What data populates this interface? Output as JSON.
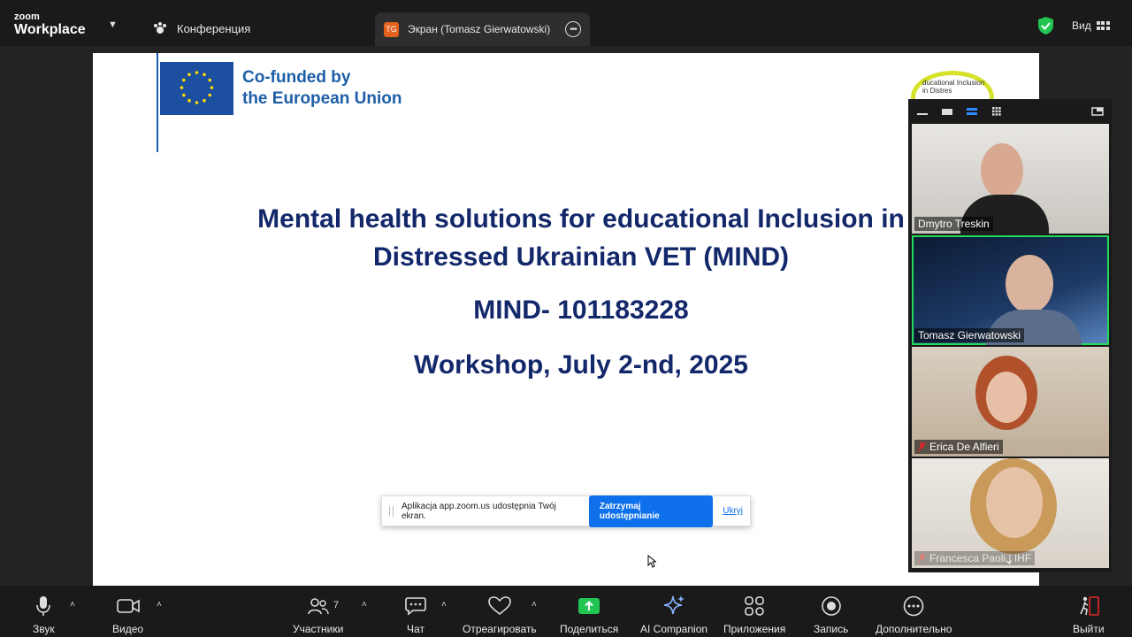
{
  "topbar": {
    "logo_small": "zoom",
    "logo_big": "Workplace",
    "meeting_label": "Конференция",
    "share_tab_initials": "TG",
    "share_tab_label": "Экран (Tomasz Gierwatowski)",
    "view_label": "Вид"
  },
  "slide": {
    "eu_text_line1": "Co-funded by",
    "eu_text_line2": "the European Union",
    "partner_logo_text": "ducational Inclusion in Distres",
    "title_line1": "Mental health solutions for educational Inclusion in",
    "title_line2": "Distressed Ukrainian VET (MIND)",
    "project_code": "MIND- 101183228",
    "workshop": "Workshop, July 2-nd, 2025"
  },
  "share_notice": {
    "message": "Aplikacja app.zoom.us udostępnia Twój ekran.",
    "stop_label": "Zatrzymaj udostępnianie",
    "hide_label": "Ukryj"
  },
  "participants": [
    {
      "name": "Dmytro Treskin",
      "muted": false,
      "active": false
    },
    {
      "name": "Tomasz Gierwatowski",
      "muted": false,
      "active": true
    },
    {
      "name": "Erica De Alfieri",
      "muted": true,
      "active": false
    },
    {
      "name": "Francesca Paoli | IHF",
      "muted": true,
      "active": false
    }
  ],
  "toolbar": {
    "audio": "Звук",
    "video": "Видео",
    "participants": "Участники",
    "participants_count": "7",
    "chat": "Чат",
    "react": "Отреагировать",
    "share": "Поделиться",
    "ai": "AI Companion",
    "apps": "Приложения",
    "record": "Запись",
    "more": "Дополнительно",
    "leave": "Выйти"
  },
  "colors": {
    "accent_blue": "#0e71eb",
    "active_speaker": "#23d959",
    "slide_title": "#13286a",
    "eu_blue": "#1d5fa8"
  }
}
